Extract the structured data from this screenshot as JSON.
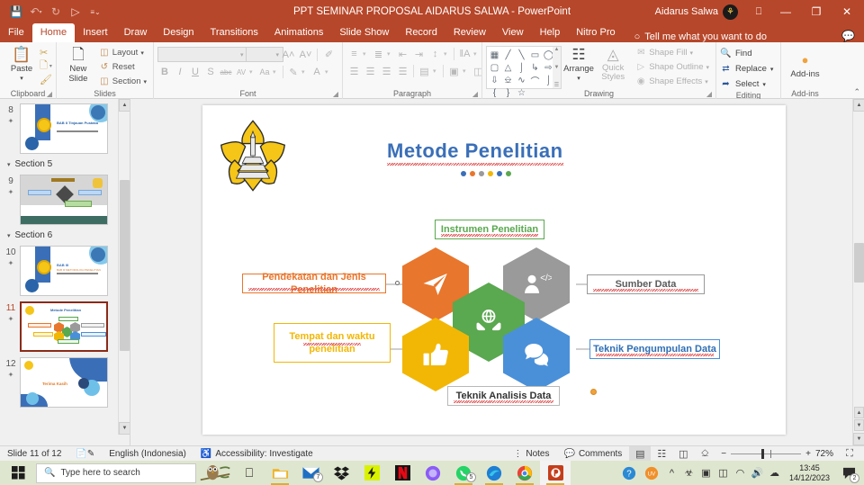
{
  "titlebar": {
    "title": "PPT SEMINAR PROPOSAL AIDARUS SALWA  -  PowerPoint",
    "user": "Aidarus Salwa",
    "avatar_glyph": "⚘",
    "qat": [
      {
        "name": "save-icon",
        "glyph": "💾"
      },
      {
        "name": "undo-icon",
        "glyph": "↶"
      },
      {
        "name": "redo-icon",
        "glyph": "↻"
      },
      {
        "name": "start-presentation-icon",
        "glyph": "▷"
      },
      {
        "name": "customize-qat-icon",
        "glyph": "⌄"
      }
    ],
    "ribbon_display_icon": "⬜",
    "minimize": "—",
    "restore": "❐",
    "close": "✕"
  },
  "tabs": [
    {
      "label": "File",
      "active": false
    },
    {
      "label": "Home",
      "active": true
    },
    {
      "label": "Insert",
      "active": false
    },
    {
      "label": "Draw",
      "active": false
    },
    {
      "label": "Design",
      "active": false
    },
    {
      "label": "Transitions",
      "active": false
    },
    {
      "label": "Animations",
      "active": false
    },
    {
      "label": "Slide Show",
      "active": false
    },
    {
      "label": "Record",
      "active": false
    },
    {
      "label": "Review",
      "active": false
    },
    {
      "label": "View",
      "active": false
    },
    {
      "label": "Help",
      "active": false
    },
    {
      "label": "Nitro Pro",
      "active": false
    }
  ],
  "tellme": {
    "label": "Tell me what you want to do",
    "bulb": "○"
  },
  "ribbon": {
    "clipboard": {
      "title": "Clipboard",
      "paste_label": "Paste",
      "cut_label": "Cut",
      "copy_label": "Copy",
      "format_painter_label": "Format Painter"
    },
    "slides": {
      "title": "Slides",
      "new_slide_label": "New Slide",
      "layout_label": "Layout",
      "reset_label": "Reset",
      "section_label": "Section"
    },
    "font": {
      "title": "Font",
      "font_name": "",
      "font_size": "",
      "bold": "B",
      "italic": "I",
      "underline": "U",
      "shadow": "S",
      "strikethrough": "abc",
      "char_spacing": "AV",
      "change_case": "Aa",
      "highlight": "✎",
      "font_color": "A",
      "grow_font": "A˄",
      "shrink_font": "A˅",
      "clear_format": "✐"
    },
    "paragraph": {
      "title": "Paragraph"
    },
    "drawing": {
      "title": "Drawing",
      "arrange_label": "Arrange",
      "quick_styles_label": "Quick Styles",
      "shape_fill_label": "Shape Fill",
      "shape_outline_label": "Shape Outline",
      "shape_effects_label": "Shape Effects",
      "shapes": [
        "☰",
        "＼",
        "↘",
        "▭",
        "◯",
        "▢",
        "△",
        "⌐",
        "↳",
        "⇨",
        "⇩",
        "⤵",
        "∫",
        "⌒",
        "∿",
        "{",
        "}",
        "☆"
      ]
    },
    "editing": {
      "title": "Editing",
      "find_label": "Find",
      "replace_label": "Replace",
      "select_label": "Select"
    },
    "addins": {
      "title": "Add-ins",
      "label": "Add-ins"
    },
    "collapse": "⌃"
  },
  "thumbnails": {
    "items": [
      {
        "kind": "slide",
        "number": "8",
        "id": "slide-8",
        "selected": false,
        "style": "bab2",
        "title": "BAB II Tinjauan Pustaka"
      },
      {
        "kind": "section",
        "label": "Section 5"
      },
      {
        "kind": "slide",
        "number": "9",
        "id": "slide-9",
        "selected": false,
        "style": "diagram"
      },
      {
        "kind": "section",
        "label": "Section 6"
      },
      {
        "kind": "slide",
        "number": "10",
        "id": "slide-10",
        "selected": false,
        "style": "bab3",
        "title": "BAB III METODOLOGI PENELITIAN"
      },
      {
        "kind": "slide",
        "number": "11",
        "id": "slide-11",
        "selected": true,
        "style": "hexes",
        "title": "Metode Penelitian"
      },
      {
        "kind": "slide",
        "number": "12",
        "id": "slide-12",
        "selected": false,
        "style": "thanks",
        "title": "Terima Kasih"
      }
    ],
    "scroll_up": "▲",
    "scroll_down": "▼"
  },
  "slide": {
    "title": "Metode Penelitian",
    "dots": [
      "#3a6fb8",
      "#e8762c",
      "#9a9a9a",
      "#f2b705",
      "#3a6fb8",
      "#5aa84f"
    ],
    "hexagons": [
      {
        "name": "hex-orange",
        "color": "#e8762c",
        "icon": "paper-plane-icon"
      },
      {
        "name": "hex-gray",
        "color": "#9a9a9a",
        "icon": "person-code-icon"
      },
      {
        "name": "hex-green",
        "color": "#5aa84f",
        "icon": "globe-hands-icon"
      },
      {
        "name": "hex-yellow",
        "color": "#f2b705",
        "icon": "thumbs-up-icon"
      },
      {
        "name": "hex-blue",
        "color": "#4a90d9",
        "icon": "chat-bubbles-icon"
      }
    ],
    "labels": {
      "pendekatan": {
        "text": "Pendekatan dan Jenis Penelitian",
        "color": "#e8762c"
      },
      "instrumen": {
        "text": "Instrumen Penelitian",
        "color": "#5aa84f"
      },
      "sumber": {
        "text": "Sumber Data",
        "color": "#9a9a9a"
      },
      "tempat_line1": {
        "text": "Tempat dan waktu",
        "color": "#f2b705"
      },
      "tempat_line2": {
        "text": "penelitian",
        "color": "#f2b705"
      },
      "teknik_pengumpulan": {
        "text": "Teknik Pengumpulan Data",
        "color": "#4a90d9"
      },
      "teknik_analisis": {
        "text": "Teknik Analisis Data",
        "color": "#3b3b3b"
      }
    }
  },
  "status": {
    "slide_counter": "Slide 11 of 12",
    "language": "English (Indonesia)",
    "accessibility": "Accessibility: Investigate",
    "notes_label": "Notes",
    "comments_label": "Comments",
    "zoom_level": "72%",
    "zoom_out": "−",
    "zoom_in": "+",
    "fit_slide": "⛶",
    "views": [
      {
        "name": "normal-view-button",
        "glyph": "▤",
        "active": true
      },
      {
        "name": "slide-sorter-button",
        "glyph": "☷",
        "active": false
      },
      {
        "name": "reading-view-button",
        "glyph": "◫",
        "active": false
      },
      {
        "name": "slide-show-button",
        "glyph": "⎐",
        "active": false
      }
    ]
  },
  "taskbar": {
    "search_placeholder": "Type here to search",
    "time": "13:45",
    "date": "14/12/2023",
    "apps": [
      {
        "name": "taskview-icon",
        "glyph": "⌸",
        "badge": "",
        "running": false
      },
      {
        "name": "file-explorer-icon",
        "glyph": "🗀",
        "badge": "",
        "running": true
      },
      {
        "name": "mail-icon",
        "glyph": "✉",
        "badge": "7",
        "running": false
      },
      {
        "name": "dropbox-icon",
        "glyph": "❖",
        "badge": "",
        "running": false
      },
      {
        "name": "flash-icon",
        "glyph": "⚡",
        "badge": "",
        "running": false
      },
      {
        "name": "netflix-icon",
        "glyph": "N",
        "badge": "",
        "running": false
      },
      {
        "name": "copilot-icon",
        "glyph": "◔",
        "badge": "",
        "running": false
      },
      {
        "name": "whatsapp-icon",
        "glyph": "✆",
        "badge": "5",
        "running": true
      },
      {
        "name": "edge-icon",
        "glyph": "◉",
        "badge": "",
        "running": true
      },
      {
        "name": "chrome-icon",
        "glyph": "◉",
        "badge": "",
        "running": true
      },
      {
        "name": "powerpoint-icon",
        "glyph": "P",
        "badge": "",
        "running": true
      }
    ],
    "tray": [
      {
        "name": "tray-expand-icon",
        "glyph": "⌃"
      },
      {
        "name": "tray-sync-icon",
        "glyph": "⛁"
      },
      {
        "name": "tray-screenshot-icon",
        "glyph": "❑"
      },
      {
        "name": "tray-battery-icon",
        "glyph": "▭"
      },
      {
        "name": "tray-wifi-icon",
        "glyph": "◠"
      },
      {
        "name": "tray-volume-icon",
        "glyph": "🔊"
      },
      {
        "name": "tray-onedrive-icon",
        "glyph": "☁"
      }
    ],
    "notification_badge": "2",
    "help_badge_icon": "help-icon",
    "uv_icon": "UV"
  }
}
